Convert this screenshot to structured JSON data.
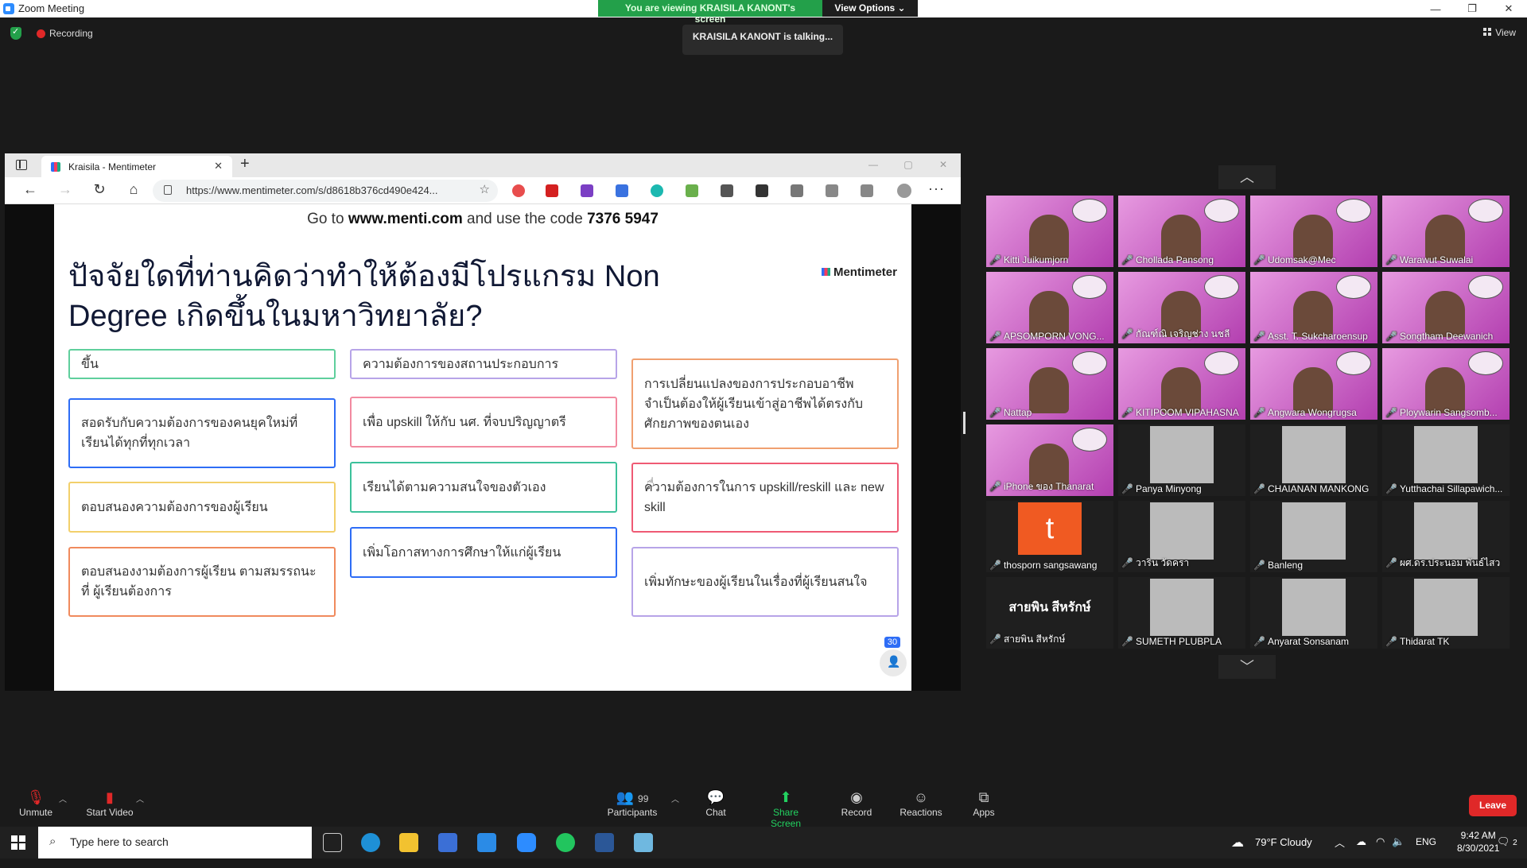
{
  "window": {
    "title": "Zoom Meeting",
    "controls": {
      "minimize": "—",
      "maximize": "❐",
      "close": "✕"
    }
  },
  "share_banner": {
    "viewing": "You are viewing KRAISILA KANONT's screen",
    "options": "View Options ⌄"
  },
  "status": {
    "recording": "Recording",
    "talking": "KRAISILA KANONT is talking...",
    "view": "View"
  },
  "browser": {
    "tab_title": "Kraisila - Mentimeter",
    "tab_close": "✕",
    "new_tab": "+",
    "nav": {
      "back": "←",
      "forward": "→",
      "reload": "↻",
      "home": "⌂"
    },
    "url": "https://www.mentimeter.com/s/d8618b376cd490e424...",
    "favorite": "☆",
    "menu": "···",
    "win_controls": {
      "minimize": "—",
      "maximize": "▢",
      "close": "✕"
    }
  },
  "slide": {
    "join_prefix": "Go to ",
    "join_site": "www.menti.com",
    "join_middle": " and use the code ",
    "join_code": "7376 5947",
    "brand": "Mentimeter",
    "question": "ปัจจัยใดที่ท่านคิดว่าทำให้ต้องมีโปรแกรม Non Degree เกิดขึ้นในมหาวิทยาลัย?",
    "responses_count": "30",
    "cards": [
      {
        "text": "ขึ้น",
        "color": "#5fcf9c"
      },
      {
        "text": "สอดรับกับความต้องการของคนยุคใหม่ที่เรียนได้ทุกที่ทุกเวลา",
        "color": "#2e6df6"
      },
      {
        "text": "ตอบสนองความต้องการของผู้เรียน",
        "color": "#f2d06b"
      },
      {
        "text": "ตอบสนองงามต้องการผู้เรียน ตามสมรรถนะที่ ผู้เรียนต้องการ",
        "color": "#f08a5d"
      },
      {
        "text": "ความต้องการของสถานประกอบการ",
        "color": "#b7a4e8"
      },
      {
        "text": "เพื่อ upskill ให้กับ นศ. ที่จบปริญญาตรี",
        "color": "#f28aa0"
      },
      {
        "text": "เรียนได้ตามความสนใจของตัวเอง",
        "color": "#3cc19b"
      },
      {
        "text": "เพิ่มโอกาสทางการศึกษาให้แก่ผู้เรียน",
        "color": "#2e6df6"
      },
      {
        "text": "การเปลี่ยนแปลงของการประกอบอาชีพ จำเป็นต้องให้ผู้เรียนเข้าสู่อาชีพได้ตรงกับศักยภาพของตนเอง",
        "color": "#f0a070"
      },
      {
        "text": "ความต้องการในการ upskill/reskill และ new skill",
        "color": "#ef5a74"
      },
      {
        "text": "เพิ่มทักษะของผู้เรียนในเรื่องที่ผู้เรียนสนใจ",
        "color": "#b7a4e8"
      }
    ]
  },
  "gallery": {
    "up": "︿",
    "down": "﹀",
    "participants": [
      "Kitti Juikumjorn",
      "Chollada Pansong",
      "Udomsak@Mec",
      "Warawut Suwalai",
      "APSOMPORN VONG...",
      "กัณฑ์ณิ เจริญช่าง นชลี",
      "Asst. T. Sukcharoensup",
      "Songtham Deewanich",
      "Nattap",
      "KITIPOOM VIPAHASNA",
      "Angwara Wongrugsa",
      "Ploywarin Sangsomb...",
      "iPhone ของ Thanarat",
      "Panya Minyong",
      "CHAIANAN MANKONG",
      "Yutthachai Sillapawich...",
      "thosporn sangsawang",
      "วาริน วัดครา",
      "Banleng",
      "ผศ.ดร.ประนอม พันธ์ไสว",
      "สายพิน สีหรักษ์",
      "SUMETH PLUBPLA",
      "Anyarat Sonsanam",
      "Thidarat TK"
    ],
    "avatar_letter": "t",
    "name_tile_text": "สายพิน สีหรักษ์"
  },
  "controls": {
    "unmute": "Unmute",
    "start_video": "Start Video",
    "participants": "Participants",
    "participants_count": "99",
    "chat": "Chat",
    "share_screen": "Share Screen",
    "record": "Record",
    "reactions": "Reactions",
    "apps": "Apps",
    "leave": "Leave"
  },
  "taskbar": {
    "search_placeholder": "Type here to search",
    "weather": "79°F  Cloudy",
    "language": "ENG",
    "time": "9:42 AM",
    "date": "8/30/2021",
    "notifications": "2"
  }
}
